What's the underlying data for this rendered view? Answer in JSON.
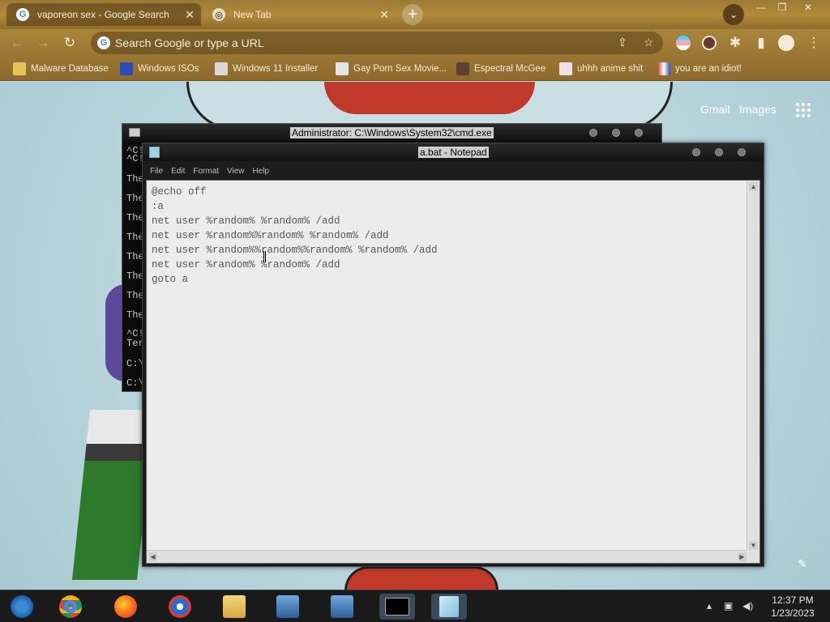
{
  "browser": {
    "tabs": [
      {
        "title": "vaporeon sex - Google Search",
        "active": true
      },
      {
        "title": "New Tab",
        "active": false
      }
    ],
    "new_tab_label": "+",
    "omnibox_placeholder": "Search Google or type a URL",
    "bookmarks": [
      {
        "label": "Malware Database",
        "icon": "folder-icon"
      },
      {
        "label": "Windows ISOs",
        "icon": "x-icon"
      },
      {
        "label": "Windows 11 Installer",
        "icon": "installer-icon"
      },
      {
        "label": "Gay Porn Sex Movie...",
        "icon": "site-icon"
      },
      {
        "label": "Espectral McGee",
        "icon": "site-icon"
      },
      {
        "label": "uhhh anime shit",
        "icon": "anime-icon"
      },
      {
        "label": "you are an idiot!",
        "icon": "flag-icon"
      }
    ]
  },
  "page": {
    "gmail_link": "Gmail",
    "images_link": "Images"
  },
  "cmd": {
    "title": "Administrator: C:\\Windows\\System32\\cmd.exe",
    "visible_lines": [
      "^C!",
      "^C!",
      "The",
      "The",
      "The",
      "The",
      "The",
      "The",
      "The",
      "The",
      "^C!",
      "Ter",
      "C:\\",
      "C:\\"
    ]
  },
  "notepad": {
    "title": "a.bat - Notepad",
    "menu": [
      "File",
      "Edit",
      "Format",
      "View",
      "Help"
    ],
    "content": "@echo off\n:a\nnet user %random% %random% /add\nnet user %random%%random% %random% /add\nnet user %random%%random%%random% %random% /add\nnet user %random% %random% /add\ngoto a"
  },
  "taskbar": {
    "time": "12:37 PM",
    "date": "1/23/2023",
    "items": [
      "start-orb",
      "chrome",
      "firefox",
      "ie",
      "explorer",
      "setup-1",
      "setup-2",
      "cmd",
      "notepad"
    ]
  },
  "colors": {
    "chrome_theme": "#a9853b",
    "taskbar": "#1a1a1a",
    "notepad_bg": "#ececec"
  }
}
